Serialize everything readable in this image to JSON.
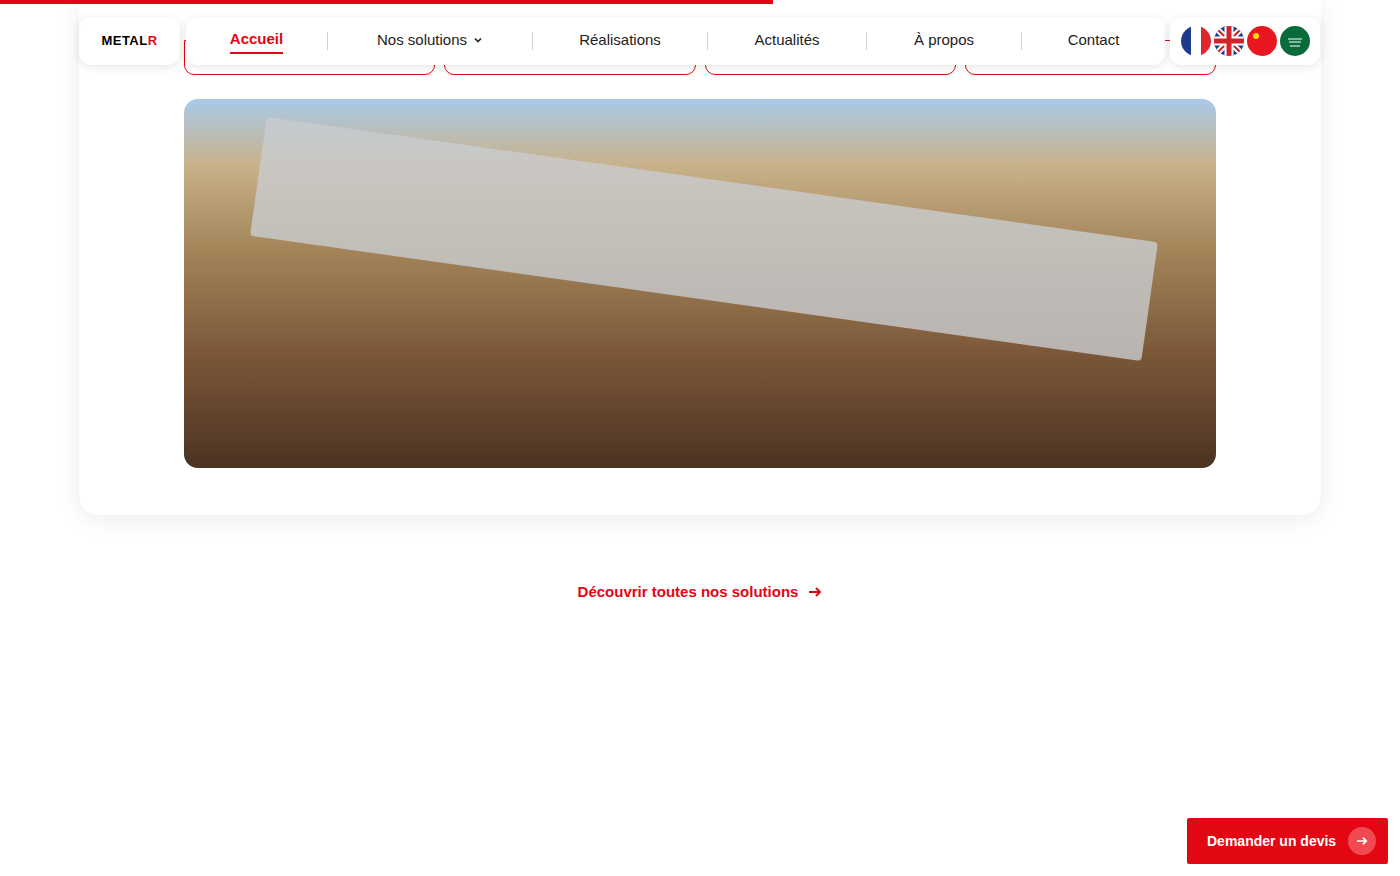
{
  "page_progress": {
    "level": 0.552
  },
  "logo": {
    "text": "METAL",
    "accent": "R"
  },
  "nav": {
    "items": [
      {
        "label": "Accueil",
        "selected": true,
        "dropdown": false
      },
      {
        "label": "Nos solutions",
        "selected": false,
        "dropdown": true
      },
      {
        "label": "Réalisations",
        "selected": false,
        "dropdown": false
      },
      {
        "label": "Actualités",
        "selected": false,
        "dropdown": false
      },
      {
        "label": "À propos",
        "selected": false,
        "dropdown": false
      },
      {
        "label": "Contact",
        "selected": false,
        "dropdown": false
      }
    ]
  },
  "languages": [
    {
      "selected": true
    },
    {
      "selected": false
    },
    {
      "selected": false
    },
    {
      "selected": false
    }
  ],
  "solution_tabs": [
    {
      "selected": false
    },
    {
      "selected": false
    },
    {
      "selected": false
    },
    {
      "selected": false
    }
  ],
  "all_solutions_link": "Découvrir toutes nos solutions",
  "quote_button": "Demander un devis"
}
